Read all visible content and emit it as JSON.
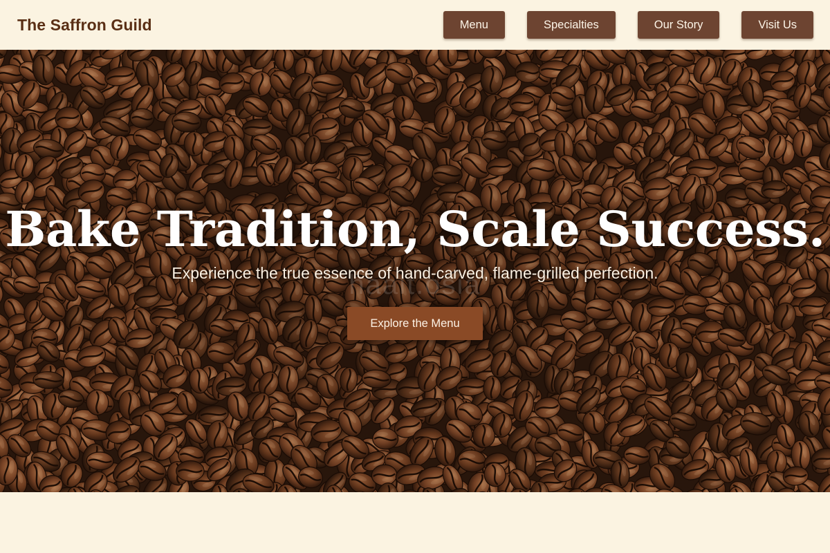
{
  "brand": {
    "name": "The Saffron Guild"
  },
  "nav": {
    "items": [
      {
        "label": "Menu"
      },
      {
        "label": "Specialties"
      },
      {
        "label": "Our Story"
      },
      {
        "label": "Visit Us"
      }
    ]
  },
  "hero": {
    "title": "Bake Tradition, Scale Success.",
    "subtitle": "Experience the true essence of hand-carved, flame-grilled perfection.",
    "watermark": "haalt.osia",
    "cta_label": "Explore the Menu",
    "background_image": "coffee-beans-photo"
  },
  "next_section": {
    "heading": ""
  },
  "colors": {
    "page_background": "#fbf3e1",
    "brand_text": "#5a2f15",
    "nav_button": "#6d4431",
    "nav_button_text": "#fdf5e8",
    "cta_button": "#8a4a26",
    "hero_text": "#ffffff"
  }
}
